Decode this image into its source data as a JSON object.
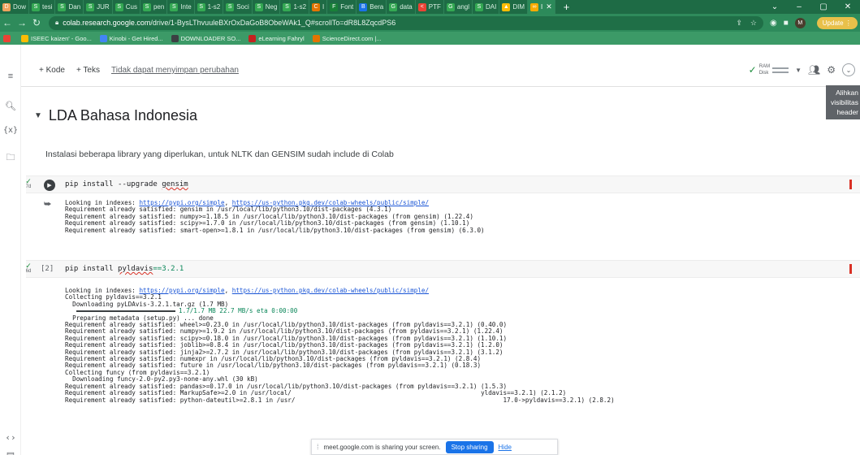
{
  "browser": {
    "tabs": [
      {
        "label": "Dow",
        "color": "#f0a35e",
        "glyph": "D"
      },
      {
        "label": "tesi",
        "color": "#34a853",
        "glyph": "S"
      },
      {
        "label": "Dan",
        "color": "#34a853",
        "glyph": "S"
      },
      {
        "label": "JUR",
        "color": "#34a853",
        "glyph": "S"
      },
      {
        "label": "Cus",
        "color": "#34a853",
        "glyph": "S"
      },
      {
        "label": "pen",
        "color": "#34a853",
        "glyph": "S"
      },
      {
        "label": "Inte",
        "color": "#34a853",
        "glyph": "S"
      },
      {
        "label": "1-s2",
        "color": "#34a853",
        "glyph": "S"
      },
      {
        "label": "Soci",
        "color": "#34a853",
        "glyph": "S"
      },
      {
        "label": "Neg",
        "color": "#34a853",
        "glyph": "S"
      },
      {
        "label": "1-s2",
        "color": "#34a853",
        "glyph": "S"
      },
      {
        "label": "I",
        "color": "#e37400",
        "glyph": "C"
      },
      {
        "label": "Font",
        "color": "#188038",
        "glyph": "F"
      },
      {
        "label": "Bera",
        "color": "#1a73e8",
        "glyph": "B"
      },
      {
        "label": "data",
        "color": "#34a853",
        "glyph": "G"
      },
      {
        "label": "PTF",
        "color": "#ea4335",
        "glyph": "<"
      },
      {
        "label": "angl",
        "color": "#34a853",
        "glyph": "G"
      },
      {
        "label": "DAI",
        "color": "#34a853",
        "glyph": "S"
      },
      {
        "label": "DIM",
        "color": "#fbbc04",
        "glyph": "▲"
      },
      {
        "label": "I",
        "color": "#f9ab00",
        "glyph": "∞"
      }
    ],
    "new_tab": "+",
    "window_controls": [
      "⌄",
      "–",
      "▢",
      "✕"
    ],
    "url_host": "colab.research.google.com",
    "url_path": "/drive/1-BysLThvuuleBXrOxDaGoB8ObeWAk1_Q#scrollTo=dR8L8ZqcdPS6",
    "avatar_letter": "M",
    "update_label": "Update",
    "bookmarks": [
      {
        "label": "ISEEC kaizen' - Goo...",
        "color": "#fbbc04"
      },
      {
        "label": "Kinobi - Get Hired...",
        "color": "#4285f4"
      },
      {
        "label": "DOWNLOADER SO...",
        "color": "#3c4043"
      },
      {
        "label": "eLearning Fahryl",
        "color": "#c5221f"
      },
      {
        "label": "ScienceDirect.com |...",
        "color": "#e37400"
      }
    ]
  },
  "colab": {
    "add_code": "+ Kode",
    "add_text": "+ Teks",
    "unsaved": "Tidak dapat menyimpan perubahan",
    "ram_label": "RAM",
    "disk_label": "Disk",
    "tooltip_lines": [
      "Alihkan",
      "visibilitas",
      "header"
    ],
    "section_title": "LDA Bahasa Indonesia",
    "intro_text": "Instalasi beberapa library yang diperlukan, untuk NLTK dan GENSIM sudah include di Colab"
  },
  "cells": {
    "cell1": {
      "exec_time": "7d",
      "code_cmd": "pip install --upgrade",
      "code_pkg": "gensim",
      "output": {
        "line1_prefix": "Looking in indexes: ",
        "link1": "https://pypi.org/simple",
        "sep": ", ",
        "link2": "https://us-python.pkg.dev/colab-wheels/public/simple/",
        "rest": [
          "Requirement already satisfied: gensim in /usr/local/lib/python3.10/dist-packages (4.3.1)",
          "Requirement already satisfied: numpy>=1.18.5 in /usr/local/lib/python3.10/dist-packages (from gensim) (1.22.4)",
          "Requirement already satisfied: scipy>=1.7.0 in /usr/local/lib/python3.10/dist-packages (from gensim) (1.10.1)",
          "Requirement already satisfied: smart-open>=1.8.1 in /usr/local/lib/python3.10/dist-packages (from gensim) (6.3.0)"
        ]
      }
    },
    "cell2": {
      "exec_time": "6d",
      "run_label": "[2]",
      "code_cmd": "pip install",
      "code_pkg": "pyldavis",
      "code_ver": "==3.2.1",
      "output": {
        "line1_prefix": "Looking in indexes: ",
        "link1": "https://pypi.org/simple",
        "sep": ", ",
        "link2": "https://us-python.pkg.dev/colab-wheels/public/simple/",
        "collecting": "Collecting pyldavis==3.2.1",
        "downloading": "  Downloading pyLDAvis-3.2.1.tar.gz (1.7 MB)",
        "progress_text": "1.7/1.7 MB 22.7 MB/s eta 0:00:00",
        "progress_fraction": 1.0,
        "rest": [
          "  Preparing metadata (setup.py) ... done",
          "Requirement already satisfied: wheel>=0.23.0 in /usr/local/lib/python3.10/dist-packages (from pyldavis==3.2.1) (0.40.0)",
          "Requirement already satisfied: numpy>=1.9.2 in /usr/local/lib/python3.10/dist-packages (from pyldavis==3.2.1) (1.22.4)",
          "Requirement already satisfied: scipy>=0.18.0 in /usr/local/lib/python3.10/dist-packages (from pyldavis==3.2.1) (1.10.1)",
          "Requirement already satisfied: joblib>=0.8.4 in /usr/local/lib/python3.10/dist-packages (from pyldavis==3.2.1) (1.2.0)",
          "Requirement already satisfied: jinja2>=2.7.2 in /usr/local/lib/python3.10/dist-packages (from pyldavis==3.2.1) (3.1.2)",
          "Requirement already satisfied: numexpr in /usr/local/lib/python3.10/dist-packages (from pyldavis==3.2.1) (2.8.4)",
          "Requirement already satisfied: future in /usr/local/lib/python3.10/dist-packages (from pyldavis==3.2.1) (0.18.3)",
          "Collecting funcy (from pyldavis==3.2.1)",
          "  Downloading funcy-2.0-py2.py3-none-any.whl (30 kB)",
          "Requirement already satisfied: pandas>=0.17.0 in /usr/local/lib/python3.10/dist-packages (from pyldavis==3.2.1) (1.5.3)",
          "Requirement already satisfied: MarkupSafe>=2.0 in /usr/local/",
          "Requirement already satisfied: python-dateutil>=2.8.1 in /usr/"
        ]
      }
    }
  },
  "share_banner": {
    "text": "meet.google.com is sharing your screen.",
    "stop_label": "Stop sharing",
    "hide_label": "Hide",
    "partial_tail1": "yldavis==3.2.1) (2.1.2)",
    "partial_tail2": "17.0->pyldavis==3.2.1) (2.8.2)"
  }
}
